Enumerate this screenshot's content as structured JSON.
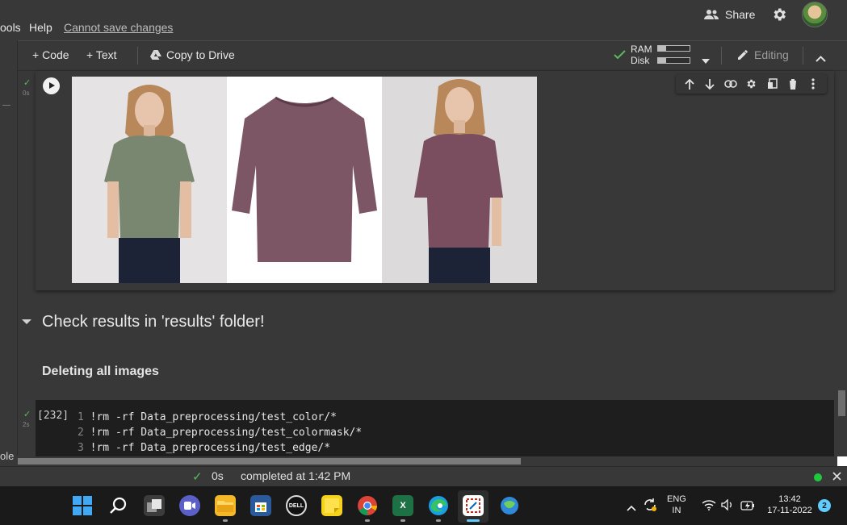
{
  "menu": {
    "tools_partial": "ools",
    "help": "Help",
    "unsaved_notice": "Cannot save changes"
  },
  "header": {
    "share_label": "Share"
  },
  "toolbar": {
    "add_code": "+ Code",
    "add_text": "+ Text",
    "copy_to_drive": "Copy to Drive",
    "ram_label": "RAM",
    "disk_label": "Disk",
    "ram_usage": 0.25,
    "disk_usage": 0.25,
    "editing_label": "Editing"
  },
  "cell1": {
    "exec_time": "0s"
  },
  "section": {
    "heading": "Check results in 'results' folder!",
    "subheading": "Deleting all images"
  },
  "code_cell": {
    "exec_count": "[232]",
    "exec_time": "2s",
    "lines": [
      {
        "num": "1",
        "code": "!rm -rf Data_preprocessing/test_color/*"
      },
      {
        "num": "2",
        "code": "!rm -rf Data_preprocessing/test_colormask/*"
      },
      {
        "num": "3",
        "code": "!rm -rf Data_preprocessing/test_edge/*"
      }
    ]
  },
  "left_rail": {
    "partial_label": "ole"
  },
  "status": {
    "duration": "0s",
    "completed": "completed at 1:42 PM"
  },
  "taskbar": {
    "lang_top": "ENG",
    "lang_bottom": "IN",
    "time": "13:42",
    "date": "17-11-2022",
    "notifications": "2"
  },
  "colors": {
    "accent_green": "#1fc93c",
    "code_bg": "#1e1e1e",
    "panel_bg": "#383838"
  }
}
